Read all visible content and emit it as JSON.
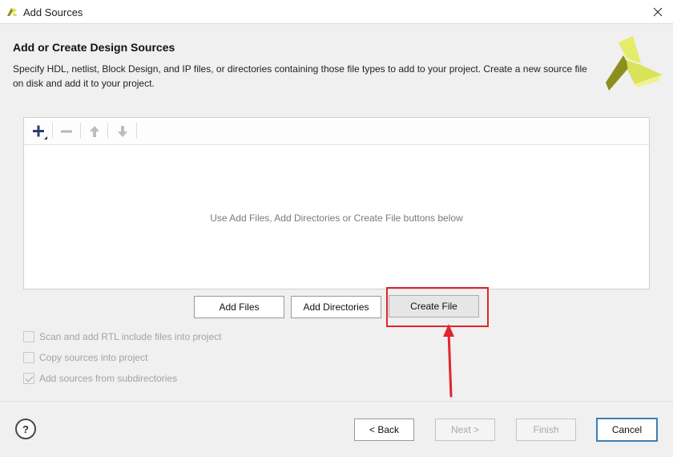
{
  "window": {
    "title": "Add Sources",
    "close_icon": "close-icon",
    "app_icon": "vivado-logo-icon"
  },
  "header": {
    "title": "Add or Create Design Sources",
    "description": "Specify HDL, netlist, Block Design, and IP files, or directories containing those file types to add to your project. Create a new source file on disk and add it to your project.",
    "logo_icon": "vivado-logo-icon"
  },
  "panel": {
    "toolbar": {
      "add_icon": "plus-icon",
      "remove_icon": "minus-icon",
      "up_icon": "arrow-up-icon",
      "down_icon": "arrow-down-icon"
    },
    "empty_message": "Use Add Files, Add Directories or Create File buttons below"
  },
  "buttons": {
    "add_files": "Add Files",
    "add_directories": "Add Directories",
    "create_file": "Create File"
  },
  "options": [
    {
      "label": "Scan and add RTL include files into project",
      "checked": false,
      "enabled": false
    },
    {
      "label": "Copy sources into project",
      "checked": false,
      "enabled": false
    },
    {
      "label": "Add sources from subdirectories",
      "checked": true,
      "enabled": false
    }
  ],
  "footer": {
    "help": "?",
    "back": "< Back",
    "next": "Next >",
    "finish": "Finish",
    "cancel": "Cancel"
  },
  "colors": {
    "highlight": "#e0262b",
    "primary_border": "#3c7fb1",
    "logo_yellow": "#d6e04a",
    "logo_olive": "#8c8f1e"
  }
}
